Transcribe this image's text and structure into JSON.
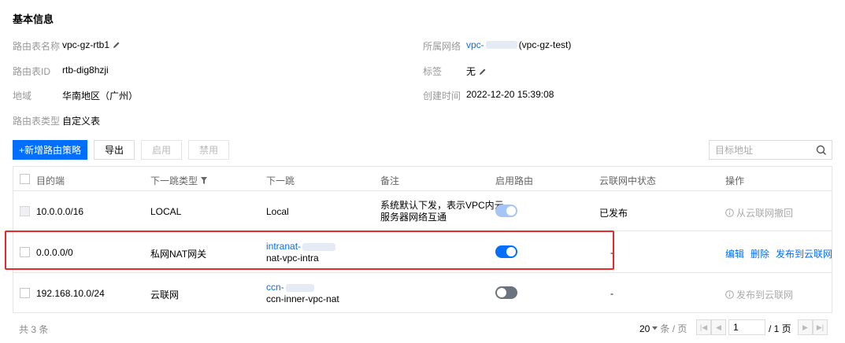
{
  "section": {
    "title": "基本信息"
  },
  "info": {
    "route_table_name_label": "路由表名称",
    "route_table_name": "vpc-gz-rtb1",
    "route_table_id_label": "路由表ID",
    "route_table_id": "rtb-dig8hzji",
    "region_label": "地域",
    "region": "华南地区（广州）",
    "route_table_type_label": "路由表类型",
    "route_table_type": "自定义表",
    "vpc_label": "所属网络",
    "vpc_prefix": "vpc-",
    "vpc_suffix": "(vpc-gz-test)",
    "tags_label": "标签",
    "tags": "无",
    "created_label": "创建时间",
    "created": "2022-12-20 15:39:08"
  },
  "toolbar": {
    "add_label": "+新增路由策略",
    "export_label": "导出",
    "enable_label": "启用",
    "disable_label": "禁用",
    "search_placeholder": "目标地址"
  },
  "table": {
    "headers": {
      "destination": "目的端",
      "next_hop_type": "下一跳类型",
      "next_hop": "下一跳",
      "remark": "备注",
      "enable_route": "启用路由",
      "ccn_status": "云联网中状态",
      "actions": "操作"
    },
    "rows": [
      {
        "destination": "10.0.0.0/16",
        "next_hop_type": "LOCAL",
        "next_hop": "Local",
        "remark_line1": "系统默认下发，表示VPC内云",
        "remark_line2": "服务器网络互通",
        "enabled": true,
        "toggle_disabled": true,
        "ccn_status": "已发布",
        "action": "从云联网撤回"
      },
      {
        "destination": "0.0.0.0/0",
        "next_hop_type": "私网NAT网关",
        "next_hop_line1": "intranat-",
        "next_hop_line2": "nat-vpc-intra",
        "enabled": true,
        "ccn_status": "-",
        "action_edit": "编辑",
        "action_delete": "删除",
        "action_publish": "发布到云联网"
      },
      {
        "destination": "192.168.10.0/24",
        "next_hop_type": "云联网",
        "next_hop_line1": "ccn-",
        "next_hop_line2": "ccn-inner-vpc-nat",
        "enabled": false,
        "ccn_status": "-",
        "action": "发布到云联网"
      }
    ]
  },
  "footer": {
    "total": "共 3 条",
    "page_size": "20",
    "page_size_unit": "条 / 页",
    "current_page": "1",
    "total_pages": "/ 1 页"
  },
  "colors": {
    "primary": "#006eff",
    "highlight": "#e8292b"
  }
}
